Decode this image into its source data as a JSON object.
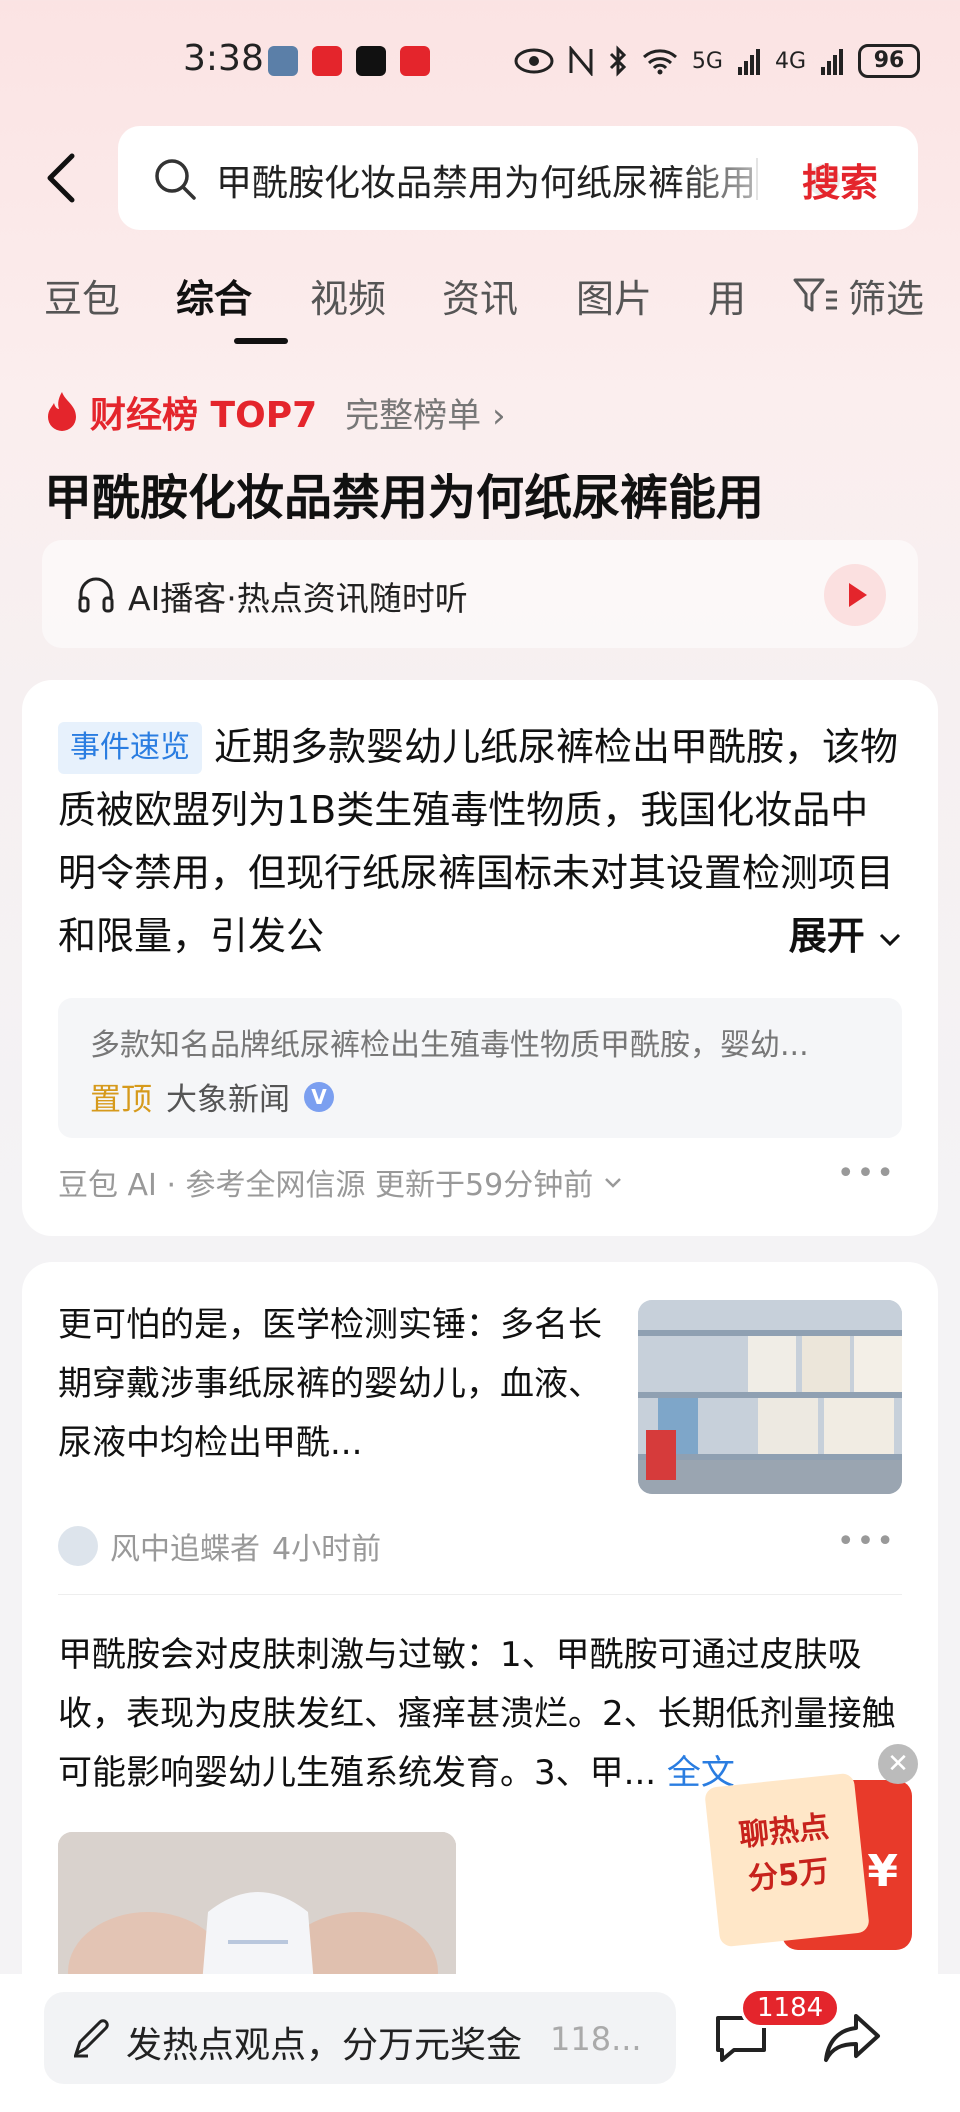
{
  "status_bar": {
    "time": "3:38",
    "battery": "96",
    "network_5g": "5G",
    "network_4g": "4G",
    "notif_colors": [
      "#5b7fa8",
      "#e4252c",
      "#111111",
      "#e4252c"
    ]
  },
  "search": {
    "query": "甲酰胺化妆品禁用为何纸尿裤能用",
    "button_label": "搜索"
  },
  "tabs": [
    {
      "label": "豆包"
    },
    {
      "label": "综合",
      "active": true
    },
    {
      "label": "视频"
    },
    {
      "label": "资讯"
    },
    {
      "label": "图片"
    },
    {
      "label": "用"
    }
  ],
  "filter_label": "筛选",
  "rank": {
    "title": "财经榜 TOP7",
    "link_label": "完整榜单 ›"
  },
  "headline": "甲酰胺化妆品禁用为何纸尿裤能用",
  "podcast": {
    "label": "AI播客·热点资讯随时听"
  },
  "summary_card": {
    "badge": "事件速览",
    "text": "近期多款婴幼儿纸尿裤检出甲酰胺，该物质被欧盟列为1B类生殖毒性物质，我国化妆品中明令禁用，但现行纸尿裤国标未对其设置检测项目和限量，引发公",
    "expand_label": "展开",
    "source_snippet": "多款知名品牌纸尿裤检出生殖毒性物质甲酰胺，婴幼...",
    "pin_label": "置顶",
    "source_name": "大象新闻",
    "footer": "豆包 AI · 参考全网信源 更新于59分钟前"
  },
  "articles": [
    {
      "text": "更可怕的是，医学检测实锤：多名长期穿戴涉事纸尿裤的婴幼儿，血液、尿液中均检出甲酰...",
      "author": "风中追蝶者",
      "time": "4小时前"
    },
    {
      "text": "甲酰胺会对皮肤刺激与过敏：1、甲酰胺可通过皮肤吸收，表现为皮肤发红、瘙痒甚溃烂。2、长期低剂量接触可能影响婴幼儿生殖系统发育。3、甲...",
      "fulltext_label": "全文"
    }
  ],
  "promo": {
    "line1": "聊热点",
    "line2": "分5万",
    "symbol": "¥"
  },
  "bottom_bar": {
    "comment_placeholder": "发热点观点，分万元奖金",
    "comment_count_short": "118...",
    "badge_count": "1184"
  },
  "colors": {
    "accent_red": "#e4252c",
    "link_blue": "#2a7de1",
    "pin_gold": "#d69a1c"
  }
}
